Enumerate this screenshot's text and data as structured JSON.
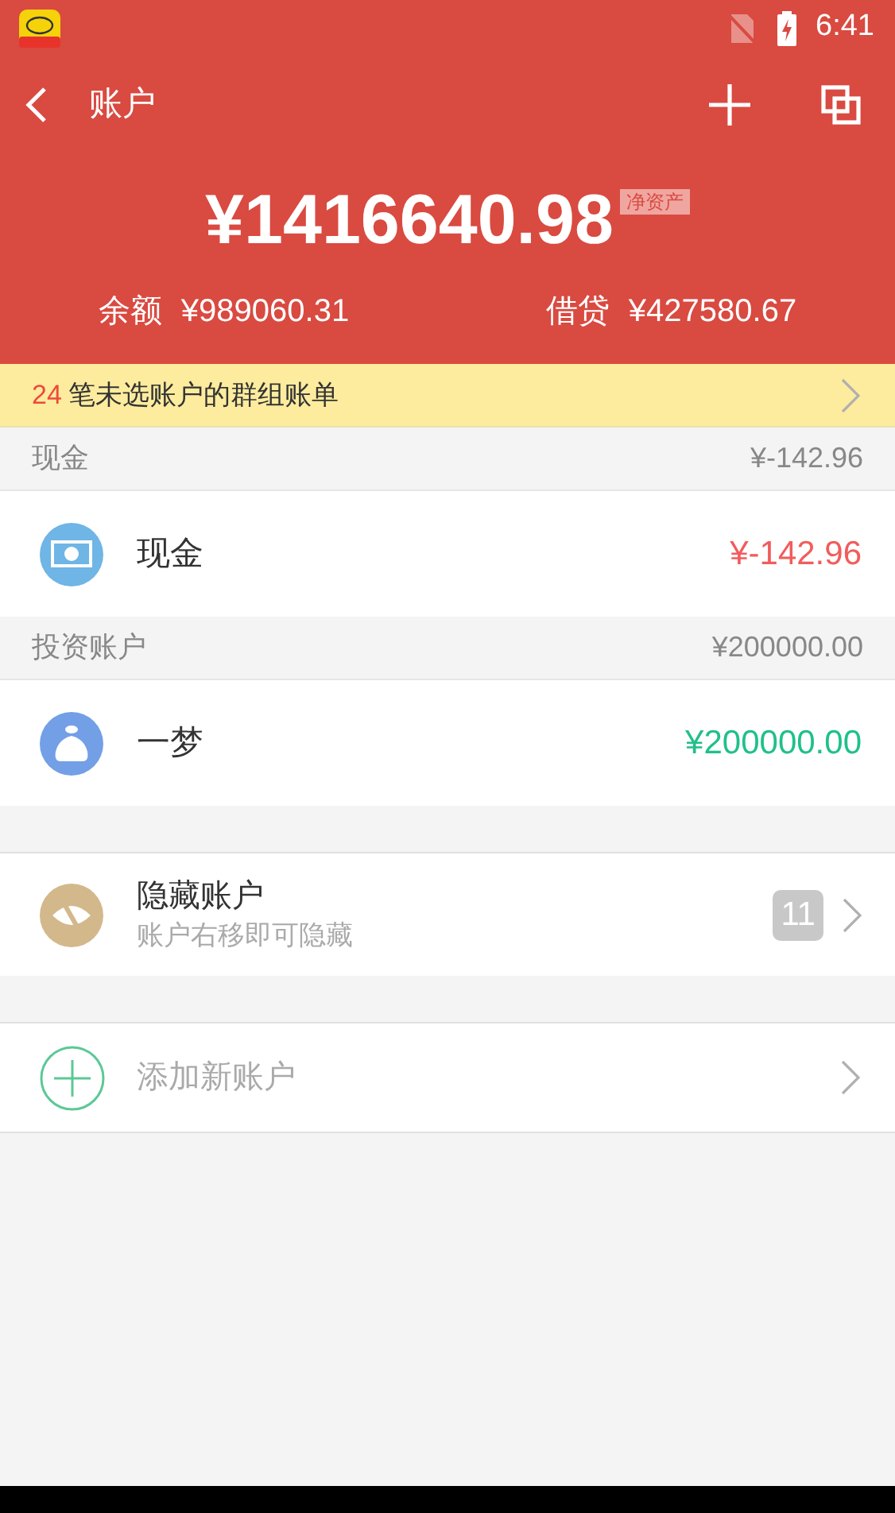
{
  "status_bar": {
    "time": "6:41"
  },
  "toolbar": {
    "title": "账户"
  },
  "summary": {
    "net_worth": "¥1416640.98",
    "net_worth_tag": "净资产",
    "balance_label": "余额",
    "balance": "¥989060.31",
    "debt_label": "借贷",
    "debt": "¥427580.67"
  },
  "notice": {
    "count": "24",
    "text": "笔未选账户的群组账单"
  },
  "groups": [
    {
      "name": "现金",
      "total": "¥-142.96",
      "accounts": [
        {
          "kind": "cash",
          "name": "现金",
          "amount": "¥-142.96",
          "color": "#f25c5c"
        }
      ]
    },
    {
      "name": "投资账户",
      "total": "¥200000.00",
      "accounts": [
        {
          "kind": "invest",
          "name": "一梦",
          "amount": "¥200000.00",
          "color": "#1fc08a"
        }
      ]
    }
  ],
  "hidden": {
    "title": "隐藏账户",
    "subtitle": "账户右移即可隐藏",
    "count": "11"
  },
  "add": {
    "label": "添加新账户"
  }
}
